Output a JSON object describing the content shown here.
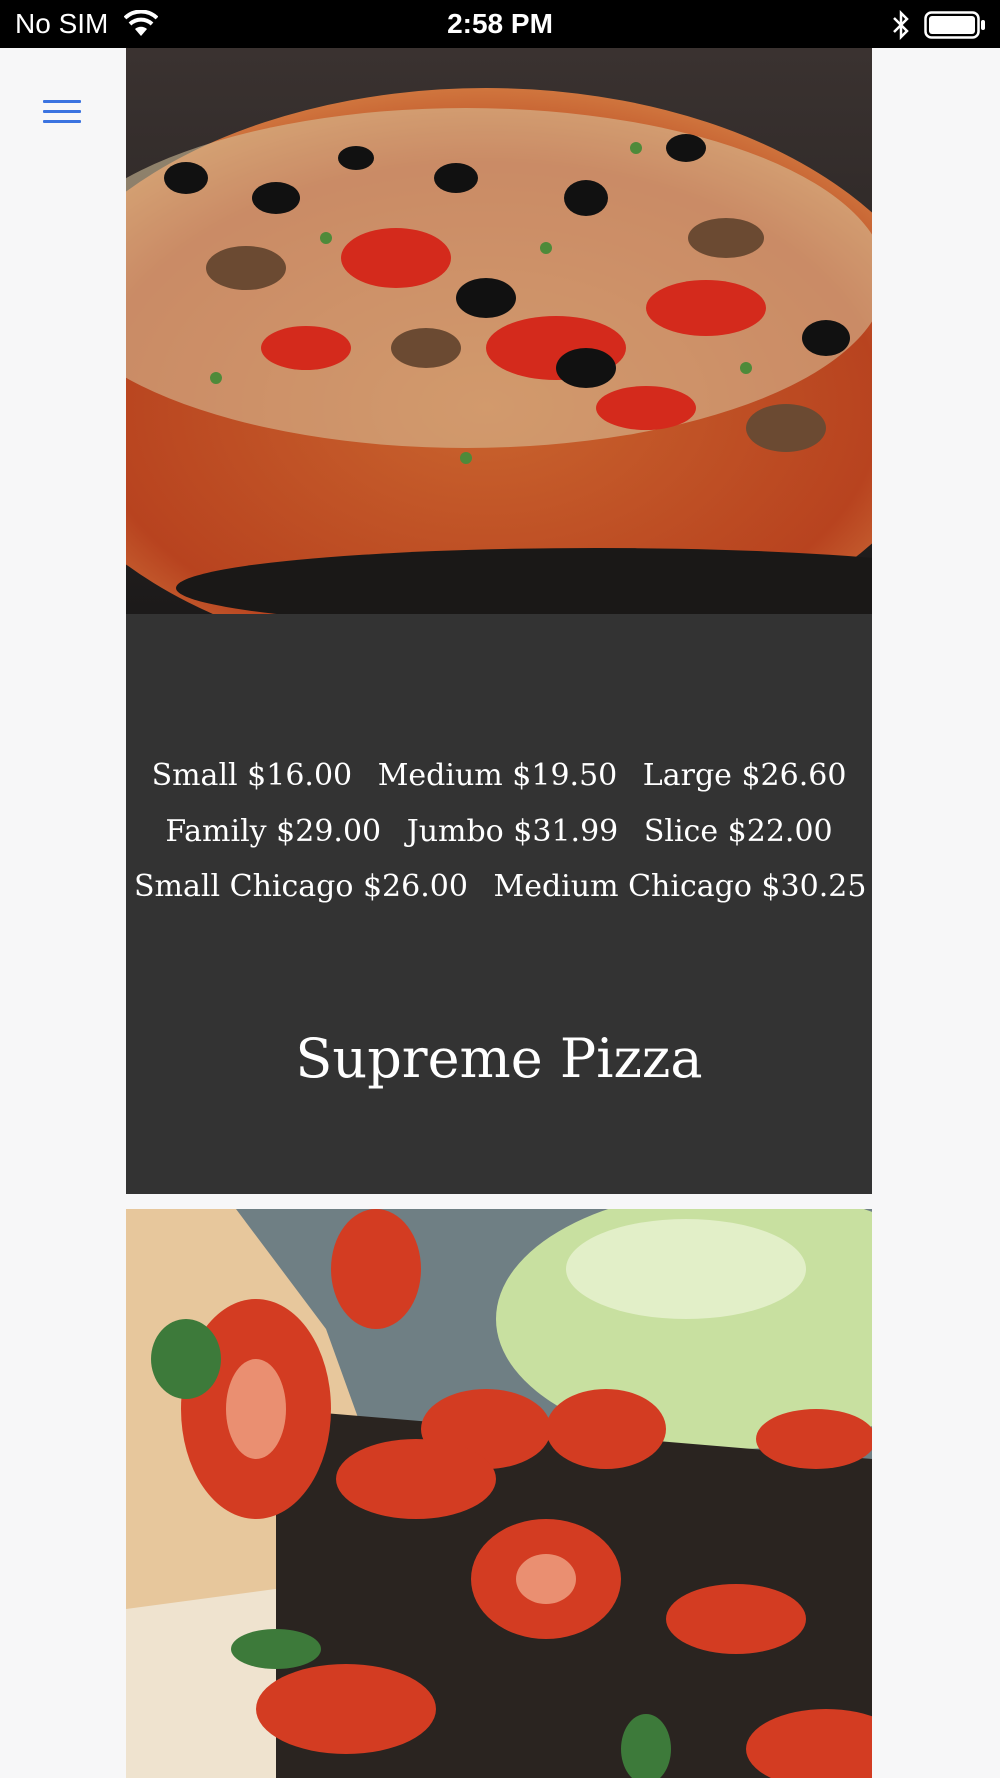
{
  "status_bar": {
    "carrier": "No SIM",
    "time": "2:58 PM"
  },
  "menu": {
    "icon": "hamburger-menu-icon",
    "color": "#3b73e0"
  },
  "item": {
    "title": "Supreme Pizza",
    "prices": [
      [
        "Small $16.00",
        "Medium $19.50",
        "Large $26.60"
      ],
      [
        "Family $29.00",
        "Jumbo $31.99",
        "Slice $22.00"
      ],
      [
        "Small Chicago $26.00",
        "Medium Chicago $30.25"
      ]
    ]
  },
  "colors": {
    "panel_background": "#333333",
    "page_background": "#f7f7f8"
  }
}
